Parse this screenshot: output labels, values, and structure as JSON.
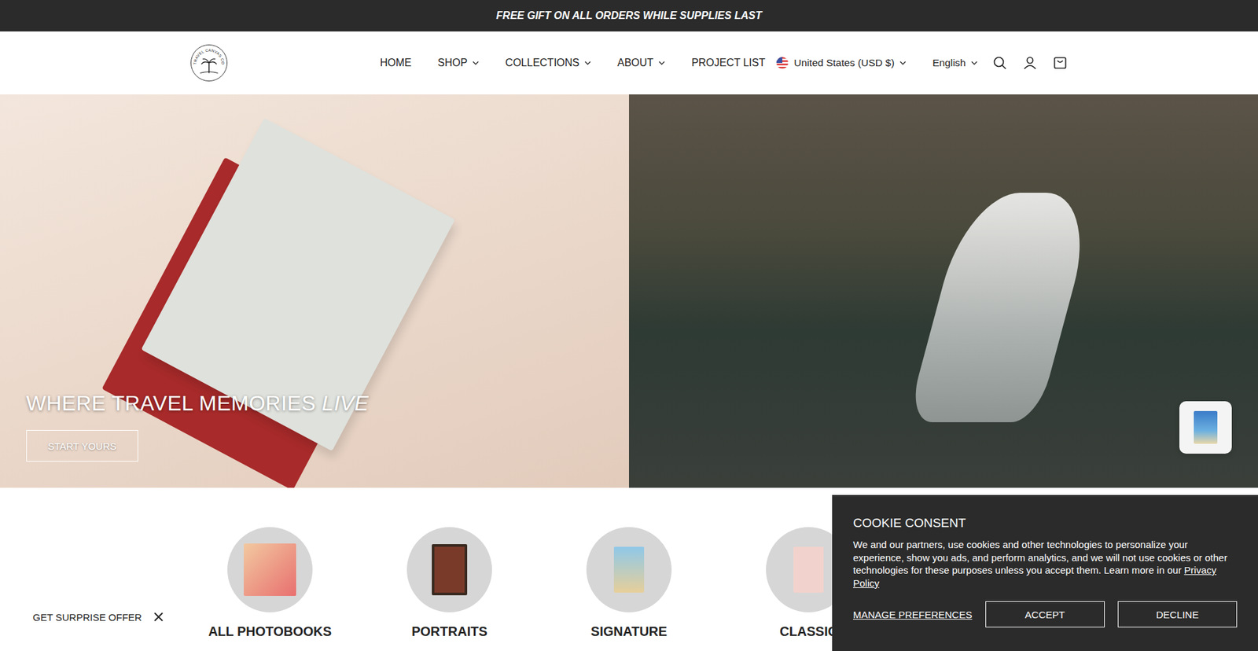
{
  "announcement": "FREE GIFT ON ALL ORDERS WHILE SUPPLIES LAST",
  "logo": {
    "text": "TRAVEL CANVAS CO"
  },
  "nav": [
    {
      "label": "HOME",
      "dropdown": false
    },
    {
      "label": "SHOP",
      "dropdown": true
    },
    {
      "label": "COLLECTIONS",
      "dropdown": true
    },
    {
      "label": "ABOUT",
      "dropdown": true
    },
    {
      "label": "PROJECT LIST",
      "dropdown": false
    }
  ],
  "locale": {
    "country": "United States (USD $)",
    "language": "English"
  },
  "hero": {
    "heading": "WHERE TRAVEL MEMORIES ",
    "heading_em": "LIVE",
    "button": "START YOURS"
  },
  "categories": [
    {
      "label": "ALL PHOTOBOOKS"
    },
    {
      "label": "PORTRAITS"
    },
    {
      "label": "SIGNATURE"
    },
    {
      "label": "CLASSIC"
    }
  ],
  "cookie": {
    "title": "COOKIE CONSENT",
    "body": "We and our partners, use cookies and other technologies to personalize your experience, show you ads, and perform analytics, and we will not use cookies or other technologies for these purposes unless you accept them. Learn more in our ",
    "link": "Privacy Policy",
    "manage": "MANAGE PREFERENCES",
    "accept": "ACCEPT",
    "decline": "DECLINE"
  },
  "offer": {
    "label": "GET SURPRISE OFFER"
  }
}
